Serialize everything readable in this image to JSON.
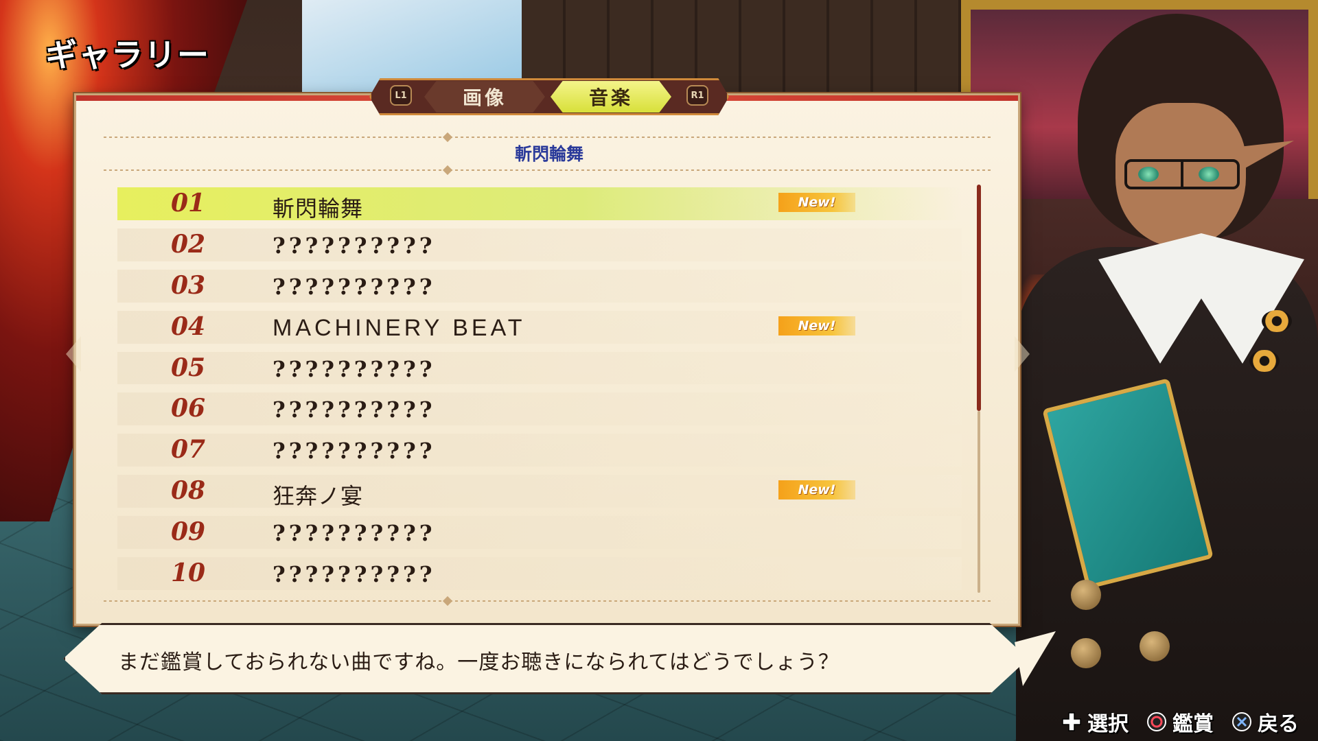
{
  "screen_title": "ギャラリー",
  "tabs": {
    "left_shoulder": "L1",
    "right_shoulder": "R1",
    "items": [
      {
        "label": "画像",
        "active": false
      },
      {
        "label": "音楽",
        "active": true
      }
    ]
  },
  "current_song_heading": "斬閃輪舞",
  "songs": [
    {
      "number": "01",
      "title": "斬閃輪舞",
      "new": "New!",
      "selected": true
    },
    {
      "number": "02",
      "title": "??????????"
    },
    {
      "number": "03",
      "title": "??????????"
    },
    {
      "number": "04",
      "title": "MACHINERY BEAT",
      "new": "New!"
    },
    {
      "number": "05",
      "title": "??????????"
    },
    {
      "number": "06",
      "title": "??????????"
    },
    {
      "number": "07",
      "title": "??????????"
    },
    {
      "number": "08",
      "title": "狂奔ノ宴",
      "new": "New!"
    },
    {
      "number": "09",
      "title": "??????????"
    },
    {
      "number": "10",
      "title": "??????????"
    }
  ],
  "scroll_position_fraction": 0.0,
  "dialog": "まだ鑑賞しておられない曲ですね。一度お聴きになられてはどうでしょう？",
  "controls": [
    {
      "icon": "dpad-icon",
      "label": "選択"
    },
    {
      "icon": "circle-button-icon",
      "label": "鑑賞"
    },
    {
      "icon": "cross-button-icon",
      "label": "戻る"
    }
  ],
  "colors": {
    "accent_active_tab": "#dde24a",
    "song_number": "#9a2a18",
    "heading": "#2a3a9a",
    "new_badge": "#f5a11a"
  }
}
